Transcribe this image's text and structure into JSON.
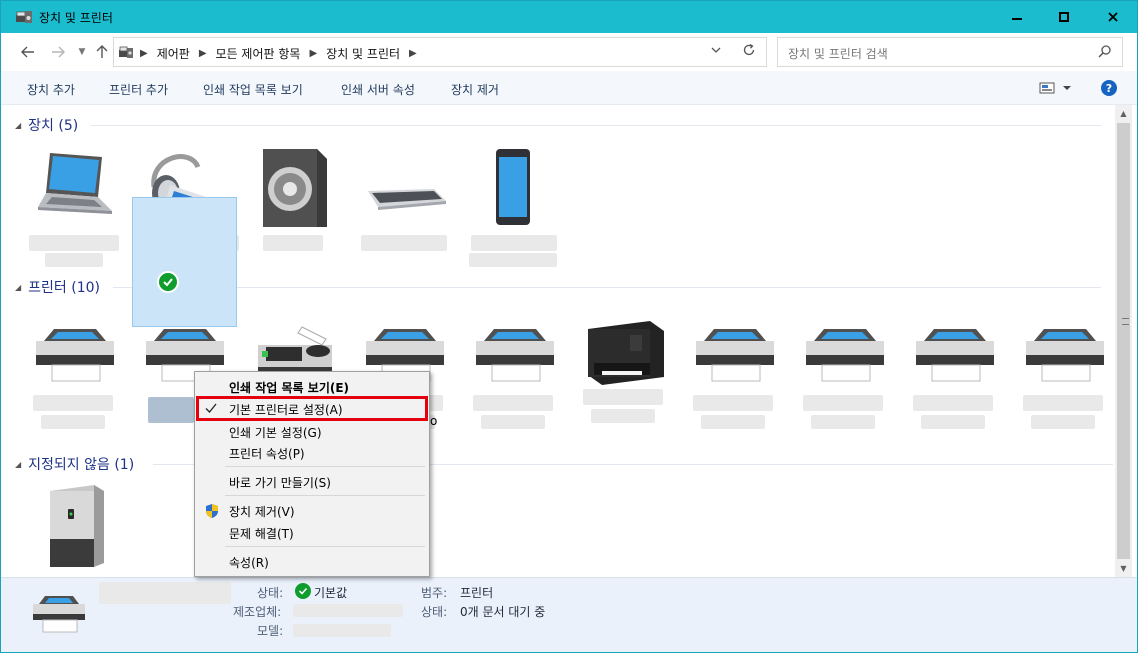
{
  "window": {
    "title": "장치 및 프린터",
    "buttons": {
      "minimize": "minimize",
      "maximize": "maximize",
      "close": "close"
    }
  },
  "address": {
    "breadcrumbs": [
      "제어판",
      "모든 제어판 항목",
      "장치 및 프린터"
    ],
    "search_placeholder": "장치 및 프린터 검색"
  },
  "commands": [
    "장치 추가",
    "프린터 추가",
    "인쇄 작업 목록 보기",
    "인쇄 서버 속성",
    "장치 제거"
  ],
  "groups": {
    "devices": {
      "label": "장치 (5)"
    },
    "printers": {
      "label": "프린터 (10)"
    },
    "unspecified": {
      "label": "지정되지 않음 (1)"
    }
  },
  "context_menu": {
    "items": [
      "인쇄 작업 목록 보기(E)",
      "기본 프린터로 설정(A)",
      "인쇄 기본 설정(G)",
      "프린터 속성(P)",
      "바로 가기 만들기(S)",
      "장치 제거(V)",
      "문제 해결(T)",
      "속성(R)"
    ],
    "checked_index": 1,
    "highlight_color": "#e5000f"
  },
  "label_fragment": "o",
  "details": {
    "status_label": "상태:",
    "status_value": "기본값",
    "manufacturer_label": "제조업체:",
    "model_label": "모델:",
    "category_label": "범주:",
    "category_value": "프린터",
    "status2_label": "상태:",
    "status2_value": "0개 문서 대기 중"
  },
  "colors": {
    "titlebar": "#1abcce",
    "accent": "#1564c0",
    "selection": "#cce4f7",
    "default_check": "#0f9d2d"
  }
}
